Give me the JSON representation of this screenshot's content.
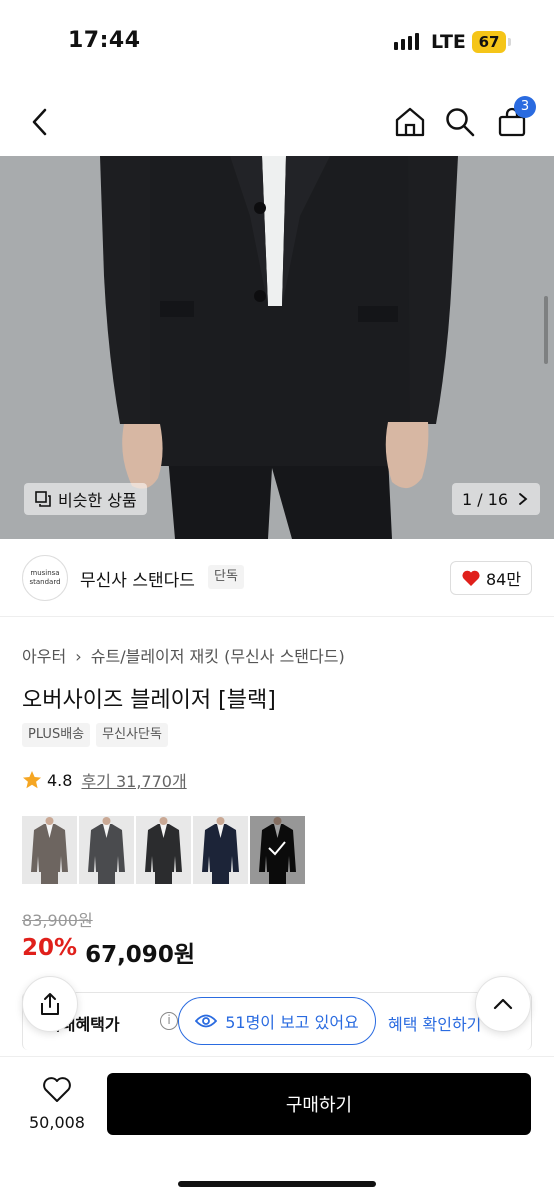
{
  "status": {
    "time": "17:44",
    "network": "LTE",
    "battery": "67"
  },
  "nav": {
    "cart_count": "3",
    "icons": [
      "back-icon",
      "home-icon",
      "search-icon",
      "cart-icon"
    ]
  },
  "hero": {
    "similar_label": "비슷한 상품",
    "pager": "1 / 16"
  },
  "brand": {
    "logo_line1": "musinsa",
    "logo_line2": "standard",
    "name": "무신사 스탠다드",
    "tag": "단독",
    "likes": "84만"
  },
  "breadcrumb": {
    "level1": "아우터",
    "level2": "슈트/블레이저 재킷 (무신사 스탠다드)"
  },
  "product": {
    "title": "오버사이즈 블레이저 [블랙]",
    "tags": [
      "PLUS배송",
      "무신사단독"
    ],
    "rating": "4.8",
    "review_label": "후기 31,770개",
    "swatch_colors": [
      "#6d6560",
      "#4a4b4e",
      "#2b2c2e",
      "#1c2438",
      "#121212"
    ],
    "selected_swatch_index": 4,
    "original_price": "83,900원",
    "discount": "20%",
    "price": "67,090원"
  },
  "benefit": {
    "label": "최대혜택가",
    "info": "i",
    "check": "혜택 확인하기"
  },
  "viewers": {
    "text": "51명이 보고 있어요"
  },
  "bottom": {
    "wish_count": "50,008",
    "buy_label": "구매하기"
  },
  "colors": {
    "accent": "#2a6be0",
    "sale": "#e0201b",
    "star": "#f5a623"
  }
}
